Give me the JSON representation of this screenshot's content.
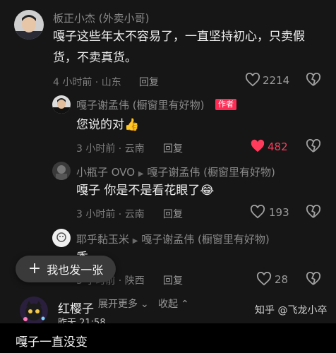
{
  "comments": {
    "main": {
      "user": "板正小杰 (外卖小哥)",
      "text_line1": "嘎子这些年太不容易了，一直坚持初心，只卖假",
      "text_line2": "货，不卖真货。",
      "meta": "4 小时前 · 山东",
      "reply": "回复",
      "likes": "2214"
    },
    "replies": [
      {
        "user": "嘎子谢孟伟 (橱窗里有好物)",
        "badge": "作者",
        "text": "您说的对",
        "emoji": "👍",
        "meta": "3 小时前 · 云南",
        "reply": "回复",
        "likes": "482"
      },
      {
        "user": "小瓶子 OVO",
        "arrow": "▶",
        "reply_to": "嘎子谢孟伟 (橱窗里有好物)",
        "text": "嘎子 你是不是看花眼了",
        "emoji": "😂",
        "meta": "3 小时前 · 云南",
        "reply": "回复",
        "likes": "193"
      },
      {
        "user": "耶乎黏玉米",
        "arrow": "▶",
        "reply_to": "嘎子谢孟伟 (橱窗里有好物)",
        "text": "秀",
        "meta": "3 小时前 · 陕西",
        "reply": "回复",
        "likes": "28"
      }
    ],
    "expand_more": "展开更多",
    "collapse": "收起"
  },
  "fab": {
    "plus": "+",
    "label": "我也发一张"
  },
  "post_author": {
    "name": "红樱子",
    "time": "昨天 21:58"
  },
  "watermark": "知乎 @飞龙小卒",
  "bottom_text": "嘎子一直没变",
  "colors": {
    "background": "#161616",
    "liked_red": "#ff3b5c",
    "author_badge": "#fe2c55"
  }
}
